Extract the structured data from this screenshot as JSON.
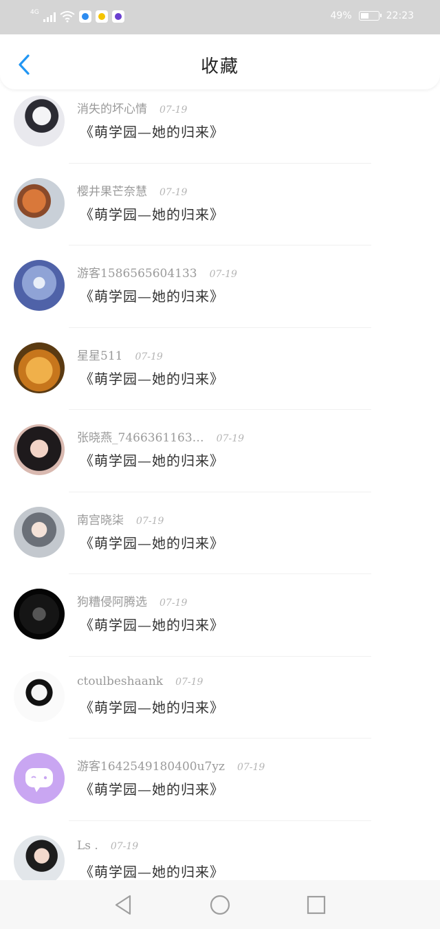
{
  "status_bar": {
    "network": "4G",
    "battery_percent": "49%",
    "battery_level": 0.49,
    "time": "22:23"
  },
  "header": {
    "title": "收藏",
    "back_icon": "chevron-left-icon"
  },
  "items": [
    {
      "username": "消失的坏心情",
      "date": "07-19",
      "title": "《萌学园—她的归来》"
    },
    {
      "username": "樱井果芒奈慧",
      "date": "07-19",
      "title": "《萌学园—她的归来》"
    },
    {
      "username": "游客1586565604133",
      "date": "07-19",
      "title": "《萌学园—她的归来》"
    },
    {
      "username": "星星511",
      "date": "07-19",
      "title": "《萌学园—她的归来》"
    },
    {
      "username": "张晓燕_7466361163…",
      "date": "07-19",
      "title": "《萌学园—她的归来》"
    },
    {
      "username": "南宫晓柒",
      "date": "07-19",
      "title": "《萌学园—她的归来》"
    },
    {
      "username": "狗糟侵阿腾选",
      "date": "07-19",
      "title": "《萌学园—她的归来》"
    },
    {
      "username": "ctoulbeshaank",
      "date": "07-19",
      "title": "《萌学园—她的归来》"
    },
    {
      "username": "游客1642549180400u7yz",
      "date": "07-19",
      "title": "《萌学园—她的归来》"
    },
    {
      "username": "Ls .",
      "date": "07-19",
      "title": "《萌学园—她的归来》"
    }
  ],
  "nav_bar": {
    "back_icon": "triangle-back-icon",
    "home_icon": "circle-home-icon",
    "recents_icon": "square-recents-icon"
  },
  "colors": {
    "status_bar_bg": "#d5d5d5",
    "accent": "#2196f3",
    "username": "#9a9a9a",
    "title": "#333333"
  }
}
